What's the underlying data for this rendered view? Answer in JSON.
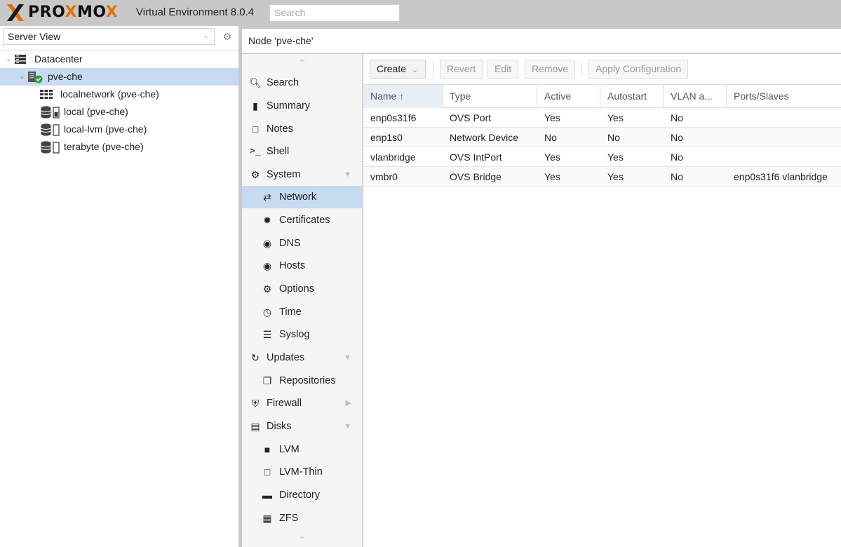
{
  "app": {
    "brand_left": "PRO",
    "brand_x": "X",
    "brand_mo": "MO",
    "brand_x2": "X",
    "version_text": "Virtual Environment 8.0.4",
    "search_placeholder": "Search",
    "accent_color": "#e57000"
  },
  "left": {
    "view_select": "Server View",
    "tree": [
      {
        "label": "Datacenter",
        "icon": "server-stack-icon"
      },
      {
        "label": "pve-che",
        "icon": "node-online-icon",
        "selected": true
      },
      {
        "label": "localnetwork (pve-che)",
        "icon": "sdn-grid-icon"
      },
      {
        "label": "local (pve-che)",
        "icon": "storage-icon"
      },
      {
        "label": "local-lvm (pve-che)",
        "icon": "storage-icon"
      },
      {
        "label": "terabyte (pve-che)",
        "icon": "storage-icon"
      }
    ]
  },
  "header": {
    "title": "Node 'pve-che'"
  },
  "menu": [
    {
      "label": "Search",
      "icon": "search-icon"
    },
    {
      "label": "Summary",
      "icon": "book-icon"
    },
    {
      "label": "Notes",
      "icon": "note-icon"
    },
    {
      "label": "Shell",
      "icon": "terminal-icon"
    },
    {
      "label": "System",
      "icon": "cogs-icon",
      "expand": "down"
    },
    {
      "label": "Network",
      "icon": "exchange-icon",
      "sub": true,
      "selected": true
    },
    {
      "label": "Certificates",
      "icon": "certificate-icon",
      "sub": true
    },
    {
      "label": "DNS",
      "icon": "globe-icon",
      "sub": true
    },
    {
      "label": "Hosts",
      "icon": "globe-icon",
      "sub": true
    },
    {
      "label": "Options",
      "icon": "gear-icon",
      "sub": true
    },
    {
      "label": "Time",
      "icon": "clock-icon",
      "sub": true
    },
    {
      "label": "Syslog",
      "icon": "list-icon",
      "sub": true
    },
    {
      "label": "Updates",
      "icon": "refresh-icon",
      "expand": "down"
    },
    {
      "label": "Repositories",
      "icon": "files-icon",
      "sub": true
    },
    {
      "label": "Firewall",
      "icon": "shield-icon",
      "expand": "right"
    },
    {
      "label": "Disks",
      "icon": "hdd-icon",
      "expand": "down"
    },
    {
      "label": "LVM",
      "icon": "square-filled-icon",
      "sub": true
    },
    {
      "label": "LVM-Thin",
      "icon": "square-outline-icon",
      "sub": true
    },
    {
      "label": "Directory",
      "icon": "folder-icon",
      "sub": true
    },
    {
      "label": "ZFS",
      "icon": "grid-icon",
      "sub": true
    }
  ],
  "toolbar": {
    "create": "Create",
    "revert": "Revert",
    "edit": "Edit",
    "remove": "Remove",
    "apply": "Apply Configuration"
  },
  "grid": {
    "columns": [
      "Name ↑",
      "Type",
      "Active",
      "Autostart",
      "VLAN a...",
      "Ports/Slaves"
    ],
    "rows": [
      [
        "enp0s31f6",
        "OVS Port",
        "Yes",
        "Yes",
        "No",
        ""
      ],
      [
        "enp1s0",
        "Network Device",
        "No",
        "No",
        "No",
        ""
      ],
      [
        "vlanbridge",
        "OVS IntPort",
        "Yes",
        "Yes",
        "No",
        ""
      ],
      [
        "vmbr0",
        "OVS Bridge",
        "Yes",
        "Yes",
        "No",
        "enp0s31f6 vlanbridge"
      ]
    ]
  }
}
